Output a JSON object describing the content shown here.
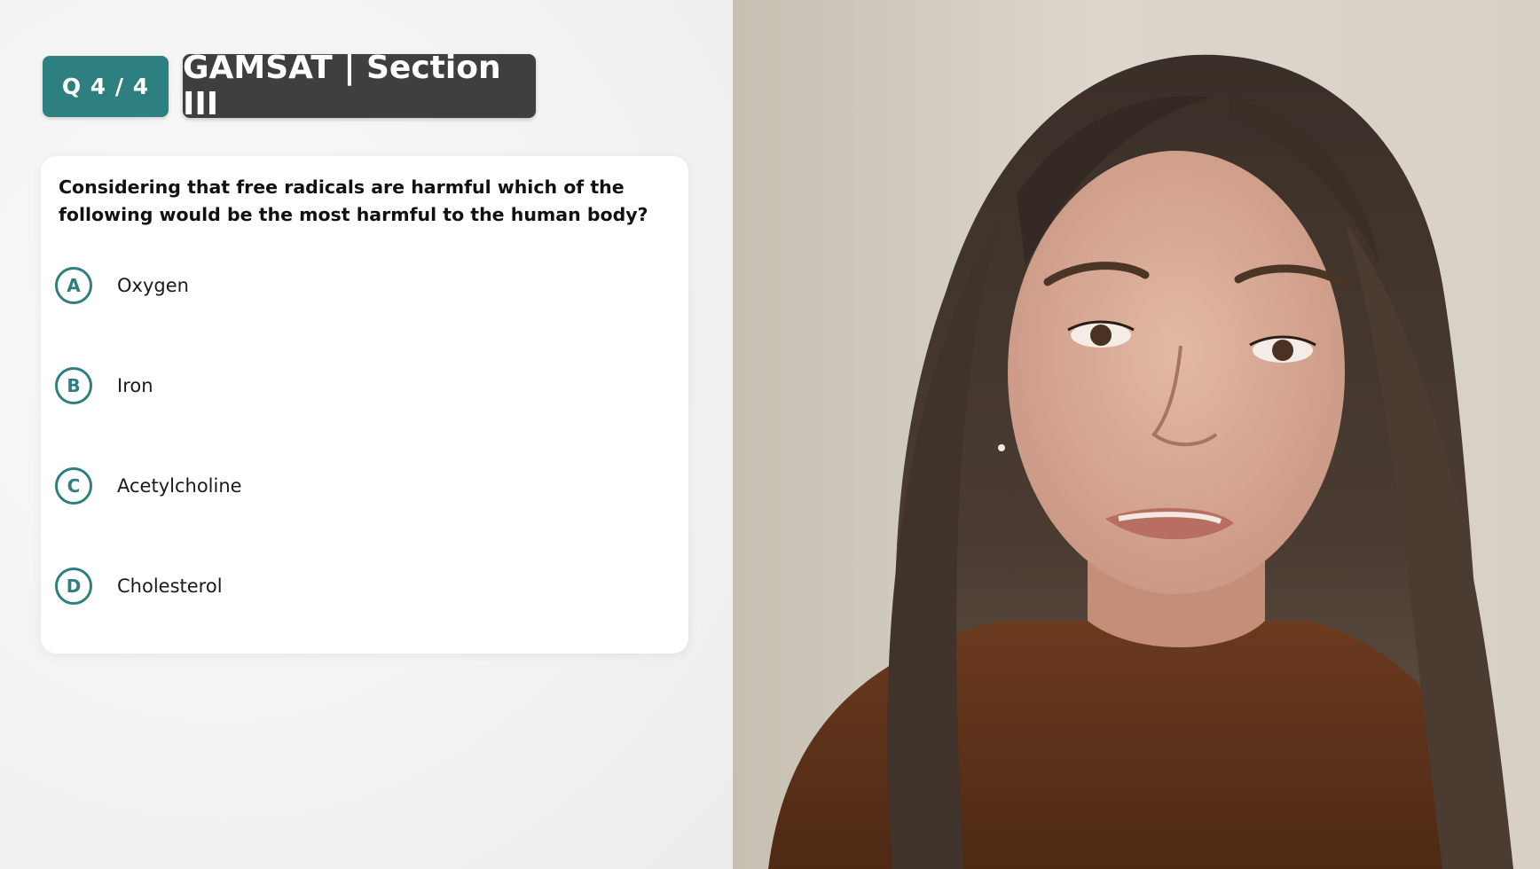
{
  "header": {
    "question_counter": "Q 4 / 4",
    "section_title": "GAMSAT | Section III"
  },
  "question": {
    "text": "Considering that free radicals are harmful which of the following would be the most harmful to the human body?",
    "options": [
      {
        "letter": "A",
        "label": "Oxygen"
      },
      {
        "letter": "B",
        "label": "Iron"
      },
      {
        "letter": "C",
        "label": "Acetylcholine"
      },
      {
        "letter": "D",
        "label": "Cholesterol"
      }
    ]
  },
  "colors": {
    "accent": "#2e7f7f",
    "section_tag_bg": "#3f3f3f"
  }
}
